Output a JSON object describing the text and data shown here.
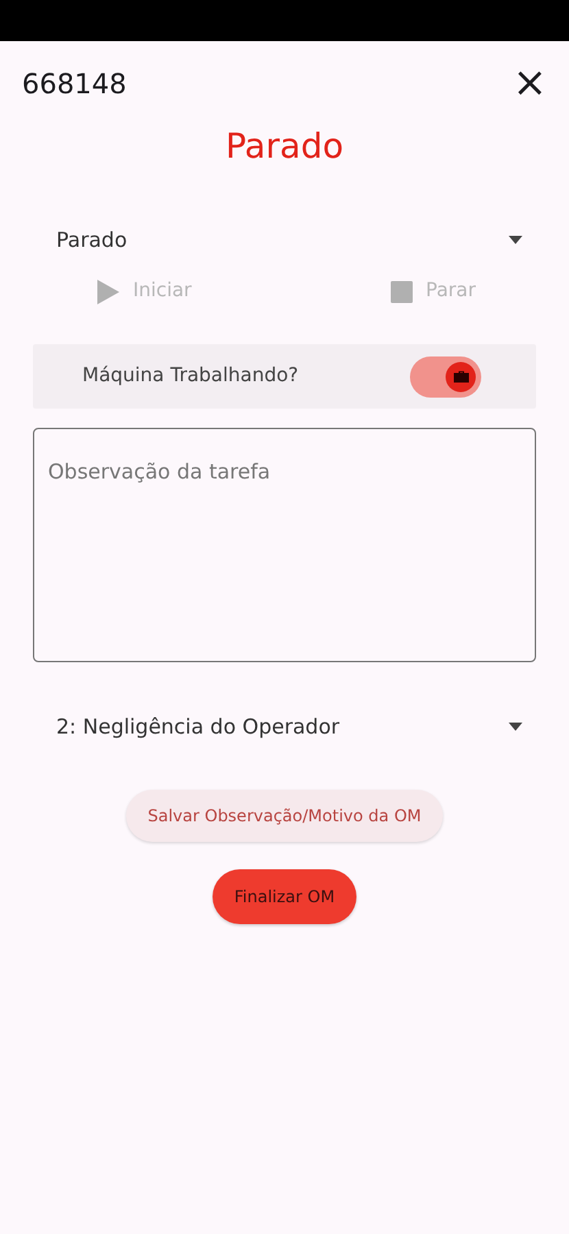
{
  "header": {
    "title": "668148",
    "close": "×"
  },
  "status_title": "Parado",
  "status_select": {
    "value": "Parado"
  },
  "actions": [
    {
      "kind": "play",
      "label": "Iniciar",
      "disabled": true
    },
    {
      "kind": "stop",
      "label": "Parar",
      "disabled": true
    }
  ],
  "machine_toggle": {
    "label": "Máquina Trabalhando?",
    "on": true
  },
  "observation": {
    "placeholder": "Observação da tarefa"
  },
  "reason_select": {
    "value": "2: Negligência do Operador"
  },
  "buttons": [
    {
      "kind": "tonal",
      "label": "Salvar Observação/Motivo da OM"
    },
    {
      "kind": "filled",
      "label": "Finalizar OM"
    }
  ]
}
